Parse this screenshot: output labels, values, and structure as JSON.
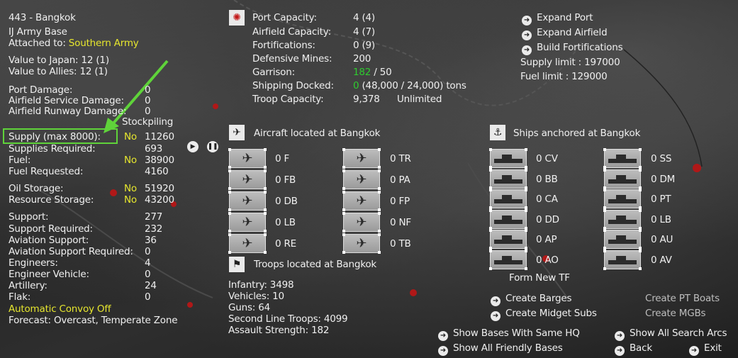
{
  "base": {
    "title": "443 - Bangkok",
    "type": "IJ Army Base",
    "attached_label": "Attached to:",
    "attached_value": "Southern Army",
    "value_japan": "Value to Japan: 12 (1)",
    "value_allies": "Value to Allies: 12 (1)"
  },
  "damage": [
    {
      "label": "Port Damage:",
      "value": "0"
    },
    {
      "label": "Airfield Service Damage:",
      "value": "0"
    },
    {
      "label": "Airfield Runway Damage:",
      "value": "0"
    }
  ],
  "stockpiling_label": "Stockpiling",
  "supply": [
    {
      "label": "Supply (max 8000):",
      "flag": "No",
      "value": "11260"
    },
    {
      "label": "Supplies Required:",
      "flag": "",
      "value": "693"
    },
    {
      "label": "Fuel:",
      "flag": "No",
      "value": "38900"
    },
    {
      "label": "Fuel Requested:",
      "flag": "",
      "value": "4160"
    }
  ],
  "storage": [
    {
      "label": "Oil Storage:",
      "flag": "No",
      "value": "51920"
    },
    {
      "label": "Resource Storage:",
      "flag": "No",
      "value": "43200"
    }
  ],
  "support": [
    {
      "label": "Support:",
      "value": "277"
    },
    {
      "label": "Support Required:",
      "value": "232"
    },
    {
      "label": "Aviation Support:",
      "value": "36"
    },
    {
      "label": "Aviation Support Required:",
      "value": "0"
    },
    {
      "label": "Engineers:",
      "value": "4"
    },
    {
      "label": "Engineer Vehicle:",
      "value": "0"
    },
    {
      "label": "Artillery:",
      "value": "24"
    },
    {
      "label": "Flak:",
      "value": "0"
    }
  ],
  "convoy": "Automatic Convoy Off",
  "forecast": "Forecast: Overcast, Temperate Zone",
  "port_info": [
    {
      "label": "Port Capacity:",
      "value": "4 (4)"
    },
    {
      "label": "Airfield Capacity:",
      "value": "4 (7)"
    },
    {
      "label": "Fortifications:",
      "value": "0 (9)"
    },
    {
      "label": "Defensive Mines:",
      "value": "200"
    }
  ],
  "garrison": {
    "label": "Garrison:",
    "value_green": "182",
    "value_rest": "/ 50"
  },
  "shipping": {
    "label": "Shipping Docked:",
    "value_green": "0",
    "value_rest": "(48,000 / 24,000) tons"
  },
  "troop_capacity": {
    "label": "Troop Capacity:",
    "value": "9,378",
    "extra": "Unlimited"
  },
  "expand": [
    {
      "label": "Expand Port"
    },
    {
      "label": "Expand Airfield"
    },
    {
      "label": "Build Fortifications"
    }
  ],
  "limits": {
    "supply": "Supply limit : 197000",
    "fuel": "Fuel limit : 129000"
  },
  "aircraft": {
    "header": "Aircraft located at Bangkok",
    "left": [
      "0 F",
      "0 FB",
      "0 DB",
      "0 LB",
      "0 RE"
    ],
    "right": [
      "0 TR",
      "0 PA",
      "0 FP",
      "0 NF",
      "0 TB"
    ]
  },
  "ships": {
    "header": "Ships anchored at Bangkok",
    "left": [
      "0 CV",
      "0 BB",
      "0 CA",
      "0 DD",
      "0 AP",
      "0 AO"
    ],
    "right": [
      "0 SS",
      "0 DM",
      "0 PT",
      "0 LB",
      "0 AU",
      "0 AV"
    ]
  },
  "form_tf": "Form New TF",
  "barges": "Create Barges",
  "midget": "Create Midget Subs",
  "pt_boats": "Create PT Boats",
  "mcbs": "Create MGBs",
  "troops": {
    "header": "Troops located at Bangkok",
    "lines": [
      "Infantry: 3498",
      "Vehicles: 10",
      "Guns: 64",
      "Second Line Troops: 4099",
      "Assault Strength: 182"
    ]
  },
  "bottom_links": {
    "same_hq": "Show Bases With Same HQ",
    "friendly": "Show All Friendly Bases",
    "search_arcs": "Show All Search Arcs",
    "back": "Back",
    "exit": "Exit"
  },
  "colors": {
    "highlight": "#5fd33a",
    "yellow": "#e6e62e",
    "green": "#2ecc2e"
  }
}
